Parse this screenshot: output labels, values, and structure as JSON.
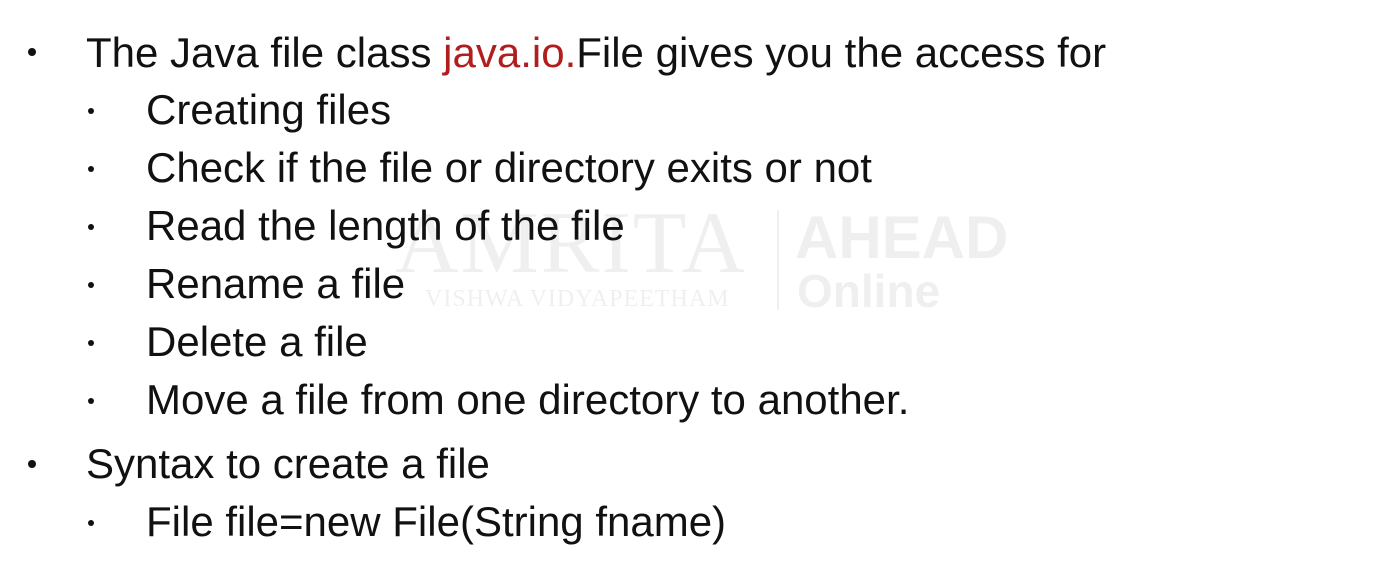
{
  "watermark": {
    "brand": "AMRITA",
    "brand_sub": "VISHWA VIDYAPEETHAM",
    "product": "AHEAD",
    "product_sub": "Online"
  },
  "content": {
    "item1": {
      "prefix": "The Java file class ",
      "highlight": "java.io.",
      "suffix": "File gives you the access for"
    },
    "sub_items": [
      "Creating files",
      "Check if the file or directory exits or not",
      "Read the length of the file",
      "Rename a file",
      "Delete a file",
      "Move a file from one directory to another."
    ],
    "item2": "Syntax to create a file",
    "syntax": "File file=new File(String fname)"
  },
  "colors": {
    "text": "#111111",
    "highlight": "#b01e1e",
    "background": "#ffffff"
  }
}
